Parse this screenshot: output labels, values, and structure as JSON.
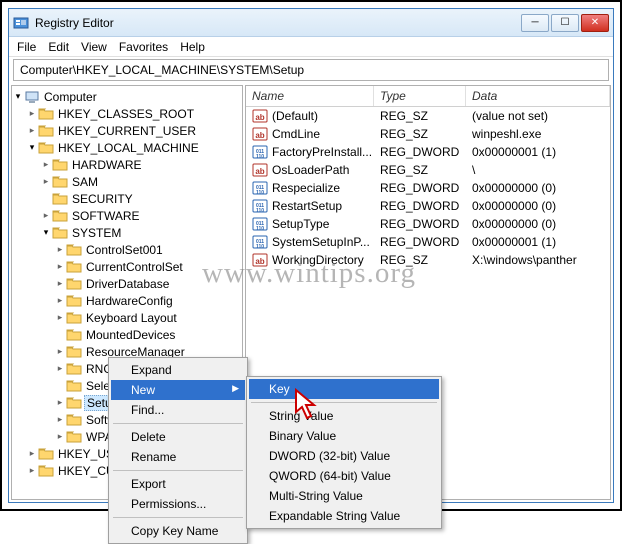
{
  "window": {
    "title": "Registry Editor"
  },
  "menus": {
    "file": "File",
    "edit": "Edit",
    "view": "View",
    "favorites": "Favorites",
    "help": "Help"
  },
  "address": "Computer\\HKEY_LOCAL_MACHINE\\SYSTEM\\Setup",
  "tree": {
    "root": "Computer",
    "hkcr": "HKEY_CLASSES_ROOT",
    "hkcu": "HKEY_CURRENT_USER",
    "hklm": "HKEY_LOCAL_MACHINE",
    "hardware": "HARDWARE",
    "sam": "SAM",
    "security": "SECURITY",
    "software": "SOFTWARE",
    "system": "SYSTEM",
    "controlset001": "ControlSet001",
    "currentcontrolset": "CurrentControlSet",
    "driverdatabase": "DriverDatabase",
    "hardwareconfig": "HardwareConfig",
    "keyboardlayout": "Keyboard Layout",
    "mounteddevices": "MountedDevices",
    "resourcemanager": "ResourceManager",
    "rng": "RNG",
    "select": "Select",
    "setup": "Setup",
    "softw": "Softw",
    "wpa": "WPA",
    "hkuse": "HKEY_USE",
    "hkcur": "HKEY_CUR"
  },
  "list_headers": {
    "name": "Name",
    "type": "Type",
    "data": "Data"
  },
  "values": [
    {
      "icon": "sz",
      "name": "(Default)",
      "type": "REG_SZ",
      "data": "(value not set)"
    },
    {
      "icon": "sz",
      "name": "CmdLine",
      "type": "REG_SZ",
      "data": "winpeshl.exe"
    },
    {
      "icon": "dw",
      "name": "FactoryPreInstall...",
      "type": "REG_DWORD",
      "data": "0x00000001 (1)"
    },
    {
      "icon": "sz",
      "name": "OsLoaderPath",
      "type": "REG_SZ",
      "data": "\\"
    },
    {
      "icon": "dw",
      "name": "Respecialize",
      "type": "REG_DWORD",
      "data": "0x00000000 (0)"
    },
    {
      "icon": "dw",
      "name": "RestartSetup",
      "type": "REG_DWORD",
      "data": "0x00000000 (0)"
    },
    {
      "icon": "dw",
      "name": "SetupType",
      "type": "REG_DWORD",
      "data": "0x00000000 (0)"
    },
    {
      "icon": "dw",
      "name": "SystemSetupInP...",
      "type": "REG_DWORD",
      "data": "0x00000001 (1)"
    },
    {
      "icon": "sz",
      "name": "WorkingDirectory",
      "type": "REG_SZ",
      "data": "X:\\windows\\panther"
    }
  ],
  "ctx_main": {
    "expand": "Expand",
    "new": "New",
    "find": "Find...",
    "delete": "Delete",
    "rename": "Rename",
    "export": "Export",
    "permissions": "Permissions...",
    "copykeyname": "Copy Key Name"
  },
  "ctx_new": {
    "key": "Key",
    "string": "String Value",
    "binary": "Binary Value",
    "dword32": "DWORD (32-bit) Value",
    "qword64": "QWORD (64-bit) Value",
    "multistring": "Multi-String Value",
    "expandable": "Expandable String Value"
  },
  "watermark": "www.wintips.org"
}
